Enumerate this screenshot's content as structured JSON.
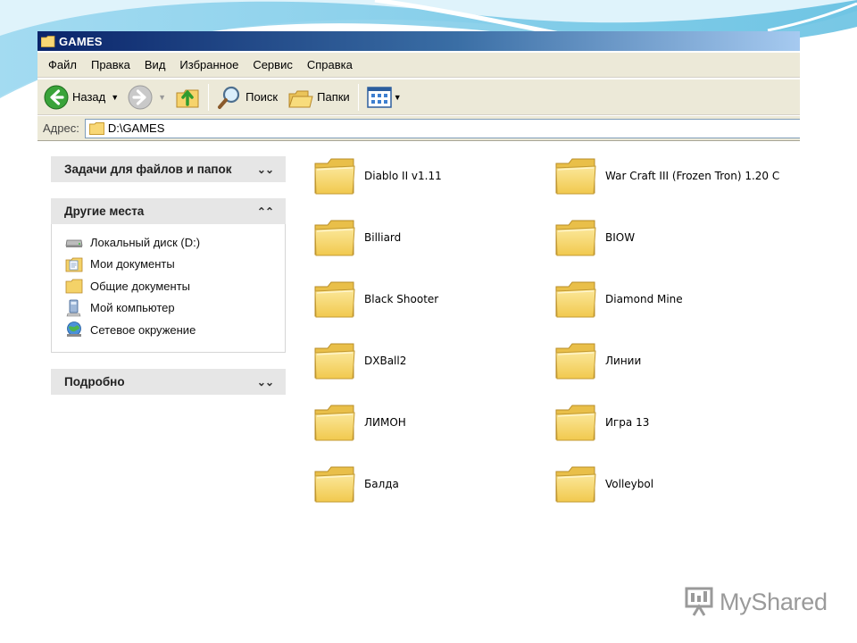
{
  "window": {
    "title": "GAMES"
  },
  "menu": [
    "Файл",
    "Правка",
    "Вид",
    "Избранное",
    "Сервис",
    "Справка"
  ],
  "toolbar": {
    "back_label": "Назад",
    "search_label": "Поиск",
    "folders_label": "Папки"
  },
  "address": {
    "label": "Адрес:",
    "value": "D:\\GAMES"
  },
  "taskpane": {
    "file_tasks": {
      "title": "Задачи для файлов и папок",
      "state": "collapsed"
    },
    "other_places": {
      "title": "Другие места",
      "state": "expanded",
      "items": [
        {
          "label": "Локальный диск (D:)",
          "icon": "drive-icon"
        },
        {
          "label": "Мои документы",
          "icon": "my-documents-icon"
        },
        {
          "label": "Общие документы",
          "icon": "folder-icon"
        },
        {
          "label": "Мой компьютер",
          "icon": "my-computer-icon"
        },
        {
          "label": "Сетевое окружение",
          "icon": "network-icon"
        }
      ]
    },
    "details": {
      "title": "Подробно",
      "state": "collapsed"
    }
  },
  "folders": [
    {
      "name": "Diablo II v1.11"
    },
    {
      "name": "War Craft III (Frozen Tron) 1.20 C"
    },
    {
      "name": "Billiard"
    },
    {
      "name": "BIOW"
    },
    {
      "name": "Black Shooter"
    },
    {
      "name": "Diamond Mine"
    },
    {
      "name": "DXBall2"
    },
    {
      "name": "Линии"
    },
    {
      "name": "ЛИМОН"
    },
    {
      "name": "Игра 13"
    },
    {
      "name": "Балда"
    },
    {
      "name": "Volleybol"
    }
  ],
  "watermark": {
    "text": "MyShared"
  },
  "colors": {
    "titlebar_start": "#0a246a",
    "titlebar_end": "#a6caf0",
    "chrome": "#ece9d8",
    "folder_fill": "#f5d66a"
  }
}
